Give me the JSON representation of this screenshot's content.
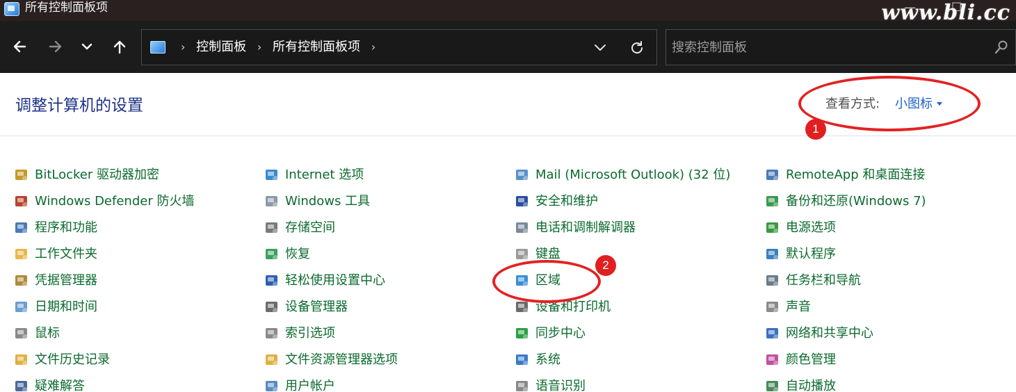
{
  "window": {
    "title": "所有控制面板项",
    "watermark": "www.bli.cc"
  },
  "nav": {
    "back_icon": "arrow-left-icon",
    "forward_icon": "arrow-right-icon",
    "recent_icon": "chevron-down-icon",
    "up_icon": "arrow-up-icon",
    "breadcrumb": [
      "控制面板",
      "所有控制面板项"
    ],
    "search_placeholder": "搜索控制面板"
  },
  "header": {
    "title": "调整计算机的设置",
    "view_by_label": "查看方式:",
    "view_by_value": "小图标"
  },
  "annotations": {
    "badge1": "1",
    "badge2": "2"
  },
  "columns": [
    [
      {
        "label": "BitLocker 驱动器加密",
        "icon": "bitlocker-key-icon"
      },
      {
        "label": "Windows Defender 防火墙",
        "icon": "firewall-brick-icon"
      },
      {
        "label": "程序和功能",
        "icon": "programs-icon"
      },
      {
        "label": "工作文件夹",
        "icon": "folder-icon"
      },
      {
        "label": "凭据管理器",
        "icon": "credential-vault-icon"
      },
      {
        "label": "日期和时间",
        "icon": "calendar-clock-icon"
      },
      {
        "label": "鼠标",
        "icon": "mouse-icon"
      },
      {
        "label": "文件历史记录",
        "icon": "file-history-icon"
      },
      {
        "label": "疑难解答",
        "icon": "troubleshoot-icon"
      }
    ],
    [
      {
        "label": "Internet 选项",
        "icon": "internet-globe-icon"
      },
      {
        "label": "Windows 工具",
        "icon": "gears-icon"
      },
      {
        "label": "存储空间",
        "icon": "storage-icon"
      },
      {
        "label": "恢复",
        "icon": "recovery-icon"
      },
      {
        "label": "轻松使用设置中心",
        "icon": "accessibility-icon"
      },
      {
        "label": "设备管理器",
        "icon": "device-manager-icon"
      },
      {
        "label": "索引选项",
        "icon": "indexing-icon"
      },
      {
        "label": "文件资源管理器选项",
        "icon": "folder-options-icon"
      },
      {
        "label": "用户帐户",
        "icon": "users-icon"
      }
    ],
    [
      {
        "label": "Mail (Microsoft Outlook) (32 位)",
        "icon": "mail-icon"
      },
      {
        "label": "安全和维护",
        "icon": "flag-icon"
      },
      {
        "label": "电话和调制解调器",
        "icon": "phone-modem-icon"
      },
      {
        "label": "键盘",
        "icon": "keyboard-icon"
      },
      {
        "label": "区域",
        "icon": "region-globe-icon"
      },
      {
        "label": "设备和打印机",
        "icon": "printer-icon"
      },
      {
        "label": "同步中心",
        "icon": "sync-icon"
      },
      {
        "label": "系统",
        "icon": "monitor-icon"
      },
      {
        "label": "语音识别",
        "icon": "microphone-icon"
      }
    ],
    [
      {
        "label": "RemoteApp 和桌面连接",
        "icon": "remoteapp-icon"
      },
      {
        "label": "备份和还原(Windows 7)",
        "icon": "backup-icon"
      },
      {
        "label": "电源选项",
        "icon": "power-battery-icon"
      },
      {
        "label": "默认程序",
        "icon": "default-programs-icon"
      },
      {
        "label": "任务栏和导航",
        "icon": "taskbar-icon"
      },
      {
        "label": "声音",
        "icon": "speaker-icon"
      },
      {
        "label": "网络和共享中心",
        "icon": "network-icon"
      },
      {
        "label": "颜色管理",
        "icon": "color-management-icon"
      },
      {
        "label": "自动播放",
        "icon": "autoplay-icon"
      }
    ]
  ]
}
